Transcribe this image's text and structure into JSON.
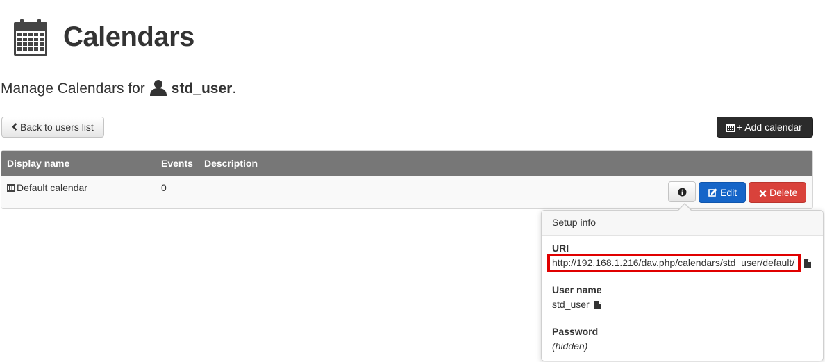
{
  "page": {
    "title": "Calendars",
    "manage_prefix": "Manage Calendars for",
    "username": "std_user",
    "manage_suffix": "."
  },
  "actions": {
    "back_label": "Back to users list",
    "add_label": "+ Add calendar"
  },
  "table": {
    "headers": [
      "Display name",
      "Events",
      "Description"
    ],
    "rows": [
      {
        "display_name": "Default calendar",
        "events": "0",
        "description": ""
      }
    ],
    "row_actions": {
      "edit_label": "Edit",
      "delete_label": "Delete"
    }
  },
  "setup_info": {
    "title": "Setup info",
    "uri_label": "URI",
    "uri_value": "http://192.168.1.216/dav.php/calendars/std_user/default/",
    "username_label": "User name",
    "username_value": "std_user",
    "password_label": "Password",
    "password_value": "(hidden)"
  },
  "colors": {
    "table_header": "#777777",
    "edit_button": "#1565c8",
    "delete_button": "#d9423b",
    "add_button": "#2b2b2b",
    "highlight_box": "#e00000"
  },
  "icons": [
    "calendar-icon",
    "user-icon",
    "chevron-left-icon",
    "info-icon",
    "edit-icon",
    "delete-icon",
    "copy-icon"
  ]
}
